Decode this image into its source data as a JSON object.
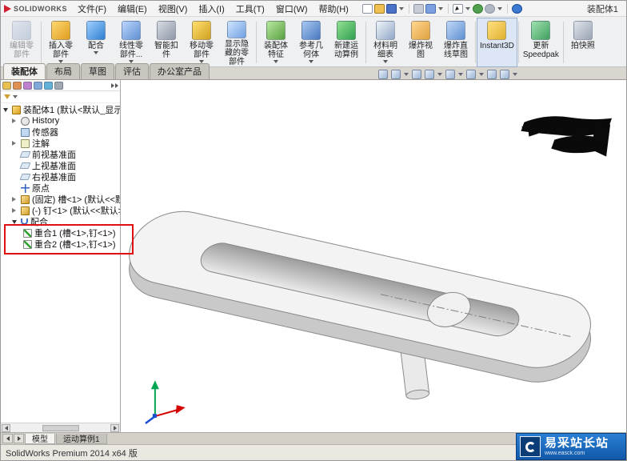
{
  "titlebar": {
    "logo_text": "SOLIDWORKS",
    "menus": [
      "文件(F)",
      "编辑(E)",
      "视图(V)",
      "插入(I)",
      "工具(T)",
      "窗口(W)",
      "帮助(H)"
    ],
    "doc_title": "装配体1"
  },
  "ribbon": {
    "buttons": [
      {
        "label": "编辑零\n部件"
      },
      {
        "label": "插入零\n部件"
      },
      {
        "label": "配合"
      },
      {
        "label": "线性零\n部件..."
      },
      {
        "label": "智能扣\n件"
      },
      {
        "label": "移动零\n部件"
      },
      {
        "label": "显示隐\n藏的零\n部件"
      },
      {
        "label": "装配体\n特征"
      },
      {
        "label": "参考几\n何体"
      },
      {
        "label": "新建运\n动算例"
      },
      {
        "label": "材料明\n细表"
      },
      {
        "label": "爆炸视\n图"
      },
      {
        "label": "爆炸直\n线草图"
      },
      {
        "label": "Instant3D"
      },
      {
        "label": "更新\nSpeedpak"
      },
      {
        "label": "拍快照"
      }
    ]
  },
  "tabs": {
    "items": [
      "装配体",
      "布局",
      "草图",
      "评估",
      "办公室产品"
    ],
    "active": "装配体"
  },
  "feature_tree": {
    "items": [
      {
        "label": "装配体1 (默认<默认_显示状态"
      },
      {
        "label": "History"
      },
      {
        "label": "传感器"
      },
      {
        "label": "注解"
      },
      {
        "label": "前视基准面"
      },
      {
        "label": "上视基准面"
      },
      {
        "label": "右视基准面"
      },
      {
        "label": "原点"
      },
      {
        "label": "(固定) 槽<1> (默认<<默认"
      },
      {
        "label": "(-) 钉<1> (默认<<默认>_显"
      },
      {
        "label": "配合"
      },
      {
        "label": "重合1 (槽<1>,钉<1>)"
      },
      {
        "label": "重合2 (槽<1>,钉<1>)"
      }
    ]
  },
  "bottom": {
    "tabs": [
      "模型",
      "运动算例1"
    ],
    "status": "SolidWorks Premium 2014 x64 版"
  },
  "watermark": {
    "title": "易采站长站",
    "subtitle": "www.easck.com"
  },
  "colors": {
    "highlight_red": "#e01010",
    "watermark_blue": "#1258a8"
  }
}
